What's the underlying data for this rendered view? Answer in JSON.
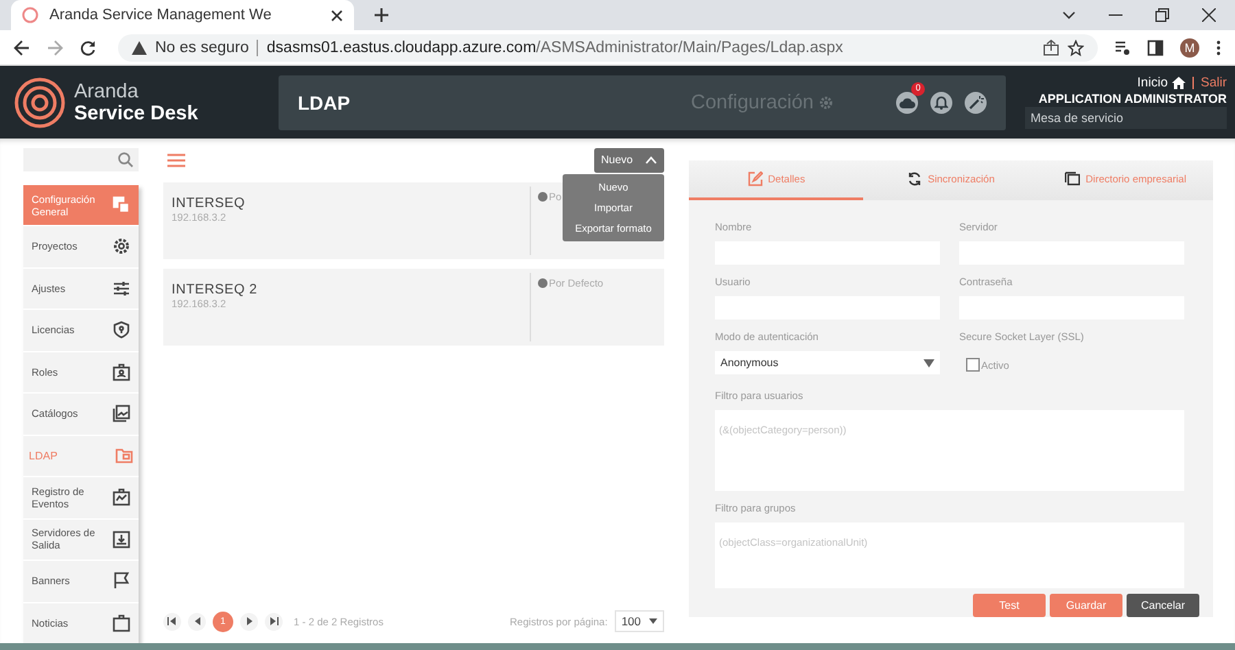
{
  "browser": {
    "tab_title": "Aranda Service Management We",
    "security": "No es seguro",
    "url_host": "dsasms01.eastus.cloudapp.azure.com",
    "url_path": "/ASMSAdministrator/Main/Pages/Ldap.aspx",
    "avatar": "M"
  },
  "header": {
    "logo_line1": "Aranda",
    "logo_line2": "Service Desk",
    "page_title": "LDAP",
    "section": "Configuración",
    "notification_count": "0",
    "home_link": "Inicio",
    "logout_link": "Salir",
    "user": "APPLICATION ADMINISTRATOR",
    "role": "Mesa de servicio"
  },
  "sidebar": {
    "items": [
      {
        "label": "Configuración General",
        "kind": "section",
        "selected": false
      },
      {
        "label": "Proyectos",
        "kind": "item",
        "selected": false
      },
      {
        "label": "Ajustes",
        "kind": "item",
        "selected": false
      },
      {
        "label": "Licencias",
        "kind": "item",
        "selected": false
      },
      {
        "label": "Roles",
        "kind": "item",
        "selected": false
      },
      {
        "label": "Catálogos",
        "kind": "item",
        "selected": false
      },
      {
        "label": "LDAP",
        "kind": "item",
        "selected": true
      },
      {
        "label": "Registro de Eventos",
        "kind": "item",
        "selected": false
      },
      {
        "label": "Servidores de Salida",
        "kind": "item",
        "selected": false
      },
      {
        "label": "Banners",
        "kind": "item",
        "selected": false
      },
      {
        "label": "Noticias",
        "kind": "item",
        "selected": false
      }
    ]
  },
  "list": {
    "new_button": {
      "label": "Nuevo",
      "expanded": true
    },
    "menu": [
      "Nuevo",
      "Importar",
      "Exportar formato"
    ],
    "cards": [
      {
        "name": "INTERSEQ",
        "address": "192.168.3.2",
        "status": "Po"
      },
      {
        "name": "INTERSEQ 2",
        "address": "192.168.3.2",
        "status": "Por Defecto"
      }
    ],
    "pagination": {
      "pages": [
        {
          "label": "1",
          "selected": true
        }
      ],
      "summary": "1 - 2 de 2 Registros",
      "per_page_label": "Registros por página:",
      "per_page": "100"
    }
  },
  "form": {
    "tabs": [
      {
        "label": "Detalles",
        "selected": true
      },
      {
        "label": "Sincronización",
        "selected": false
      },
      {
        "label": "Directorio empresarial",
        "selected": false
      }
    ],
    "fields": [
      {
        "kind": "text",
        "label": "Nombre"
      },
      {
        "kind": "text",
        "label": "Servidor"
      },
      {
        "kind": "text",
        "label": "Usuario"
      },
      {
        "kind": "text",
        "label": "Contraseña"
      },
      {
        "kind": "select",
        "label": "Modo de autenticación",
        "value": "Anonymous"
      },
      {
        "kind": "checkbox",
        "label": "Secure Socket Layer (SSL)",
        "option": "Activo",
        "checked": false
      },
      {
        "kind": "textarea",
        "label": "Filtro para usuarios",
        "placeholder": "(&(objectCategory=person))"
      },
      {
        "kind": "textarea",
        "label": "Filtro para grupos",
        "placeholder": "(objectClass=organizationalUnit)"
      }
    ],
    "buttons": [
      {
        "label": "Test",
        "kind": "primary"
      },
      {
        "label": "Guardar",
        "kind": "primary"
      },
      {
        "label": "Cancelar",
        "kind": "dark"
      }
    ]
  }
}
